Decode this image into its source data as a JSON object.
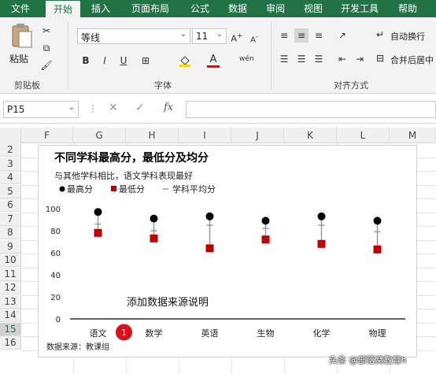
{
  "ribbon_tabs": [
    {
      "label": "文件"
    },
    {
      "label": "开始"
    },
    {
      "label": "插入"
    },
    {
      "label": "页面布局"
    },
    {
      "label": "公式"
    },
    {
      "label": "数据"
    },
    {
      "label": "审阅"
    },
    {
      "label": "视图"
    },
    {
      "label": "开发工具"
    },
    {
      "label": "帮助"
    }
  ],
  "clipboard": {
    "paste_label": "粘贴",
    "group_label": "剪贴板"
  },
  "font": {
    "name": "等线",
    "size": "11",
    "group_label": "字体",
    "bold": "B",
    "italic": "I",
    "underline": "U",
    "wen": "wén",
    "font_color_glyph": "A"
  },
  "alignment": {
    "wrap_label": "自动换行",
    "merge_label": "合并后居中",
    "group_label": "对齐方式"
  },
  "formula_bar": {
    "name_box": "P15",
    "fx": "fx",
    "cancel": "✕",
    "confirm": "✓"
  },
  "columns": [
    "F",
    "G",
    "H",
    "I",
    "J",
    "K",
    "L",
    "M"
  ],
  "rows": [
    "2",
    "3",
    "4",
    "5",
    "6",
    "7",
    "8",
    "9",
    "10",
    "11",
    "12",
    "13",
    "14",
    "15",
    "16"
  ],
  "active_row": "15",
  "chart_data": {
    "type": "line",
    "title": "不同学科最高分，最低分及均分",
    "subtitle": "与其他学科相比，语文学科表现最好",
    "categories": [
      "语文",
      "数学",
      "英语",
      "生物",
      "化学",
      "物理"
    ],
    "series": [
      {
        "name": "最高分",
        "values": [
          97,
          91,
          93,
          89,
          93,
          89
        ],
        "color": "#000000",
        "marker": "circle"
      },
      {
        "name": "最低分",
        "values": [
          78,
          73,
          64,
          72,
          68,
          63
        ],
        "color": "#c00000",
        "marker": "square"
      },
      {
        "name": "学科平均分",
        "values": [
          86,
          80,
          85,
          82,
          85,
          79
        ],
        "color": "#999999",
        "marker": "dash"
      }
    ],
    "yticks": [
      0,
      20,
      40,
      60,
      80,
      100
    ],
    "ylim": [
      0,
      100
    ],
    "annotation": "添加数据来源说明",
    "source": "数据来源：教课组",
    "badge": "1"
  },
  "watermark": "头条 @部落窝教育h"
}
